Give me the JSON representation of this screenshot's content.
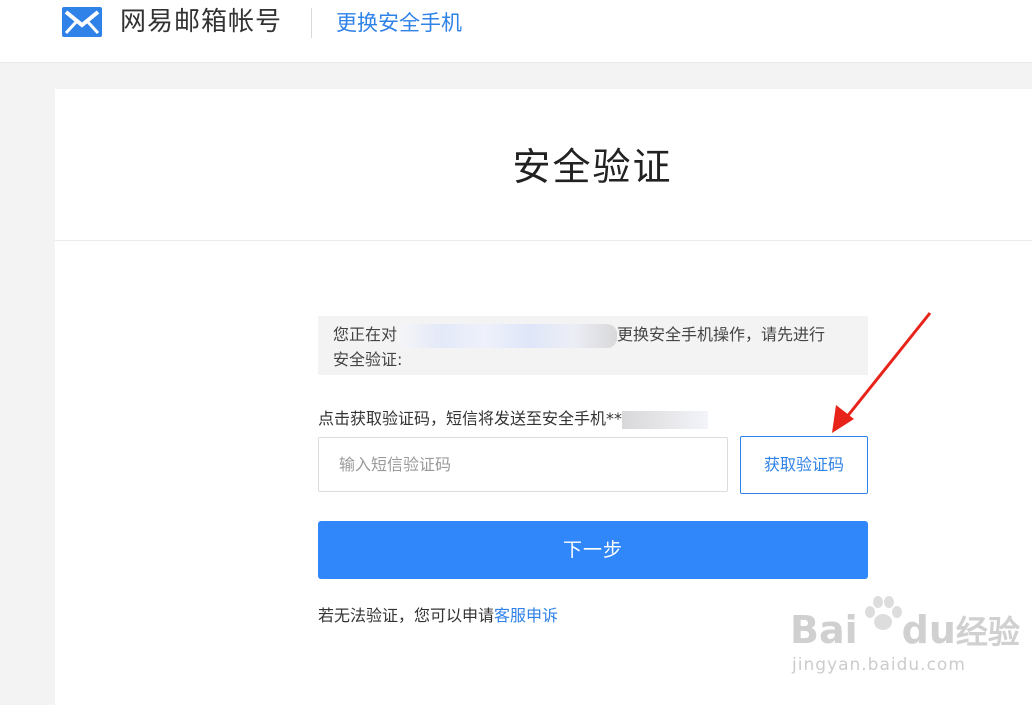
{
  "header": {
    "brand": "网易邮箱帐号",
    "page_link": "更换安全手机",
    "logo_icon": "mail-envelope-icon",
    "accent": "#2f82e8"
  },
  "card": {
    "title": "安全验证"
  },
  "notice": {
    "prefix": "您正在对",
    "suffix": "更换安全手机操作，请先进行",
    "line2": "安全验证:"
  },
  "sms": {
    "hint": "点击获取验证码，短信将发送至安全手机**",
    "placeholder": "输入短信验证码",
    "value": "",
    "get_code_label": "获取验证码"
  },
  "next_button": {
    "label": "下一步",
    "color": "#2f87fa"
  },
  "appeal": {
    "text": "若无法验证，您可以申请",
    "link": "客服申诉"
  },
  "annotation": {
    "arrow_color": "#e8231a"
  },
  "watermark": {
    "brand": "Bai",
    "brand_end": "du",
    "product": "经验",
    "url": "jingyan.baidu.com"
  }
}
